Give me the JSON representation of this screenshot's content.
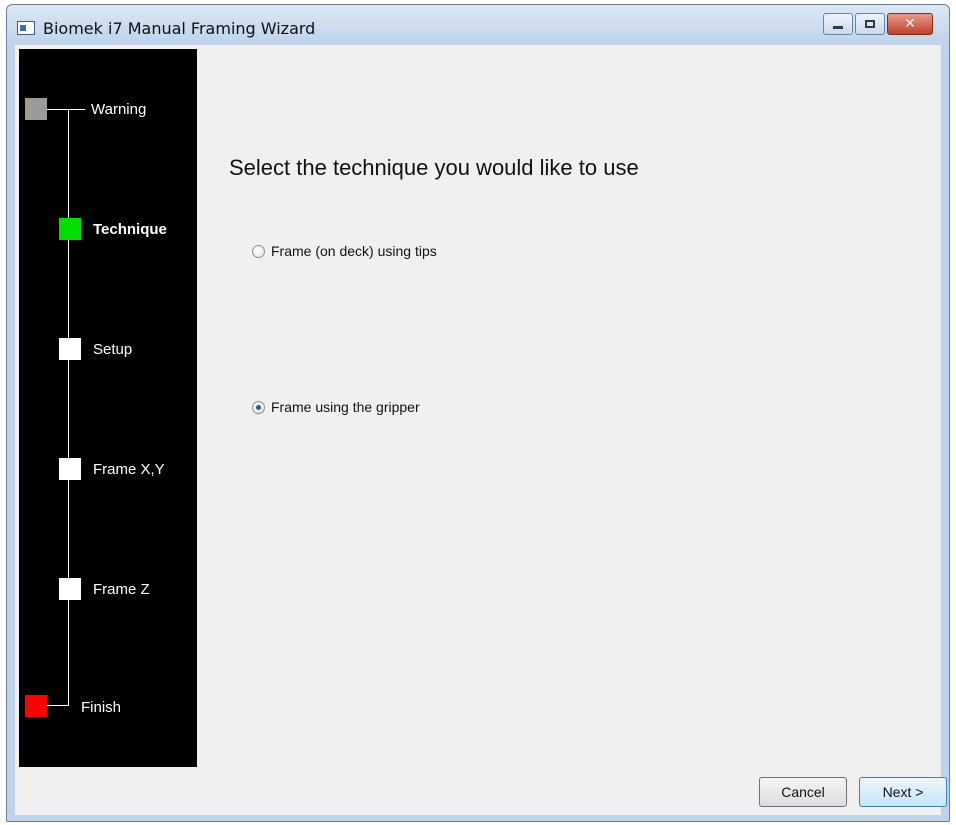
{
  "window": {
    "title": "Biomek i7 Manual Framing Wizard",
    "controls": {
      "minimize_icon": "minimize-icon",
      "maximize_icon": "maximize-icon",
      "close_icon": "close-icon"
    }
  },
  "sidebar": {
    "steps": [
      {
        "label": "Warning",
        "color": "#9a9a9a",
        "active": false
      },
      {
        "label": "Technique",
        "color": "#00e000",
        "active": true
      },
      {
        "label": "Setup",
        "color": "#ffffff",
        "active": false
      },
      {
        "label": "Frame X,Y",
        "color": "#ffffff",
        "active": false
      },
      {
        "label": "Frame Z",
        "color": "#ffffff",
        "active": false
      },
      {
        "label": "Finish",
        "color": "#ff0000",
        "active": false
      }
    ]
  },
  "main": {
    "heading": "Select the technique you would like to use",
    "options": [
      {
        "label": "Frame (on deck) using tips",
        "selected": false
      },
      {
        "label": "Frame using the gripper",
        "selected": true
      }
    ]
  },
  "footer": {
    "cancel_label": "Cancel",
    "next_label": "Next >"
  }
}
